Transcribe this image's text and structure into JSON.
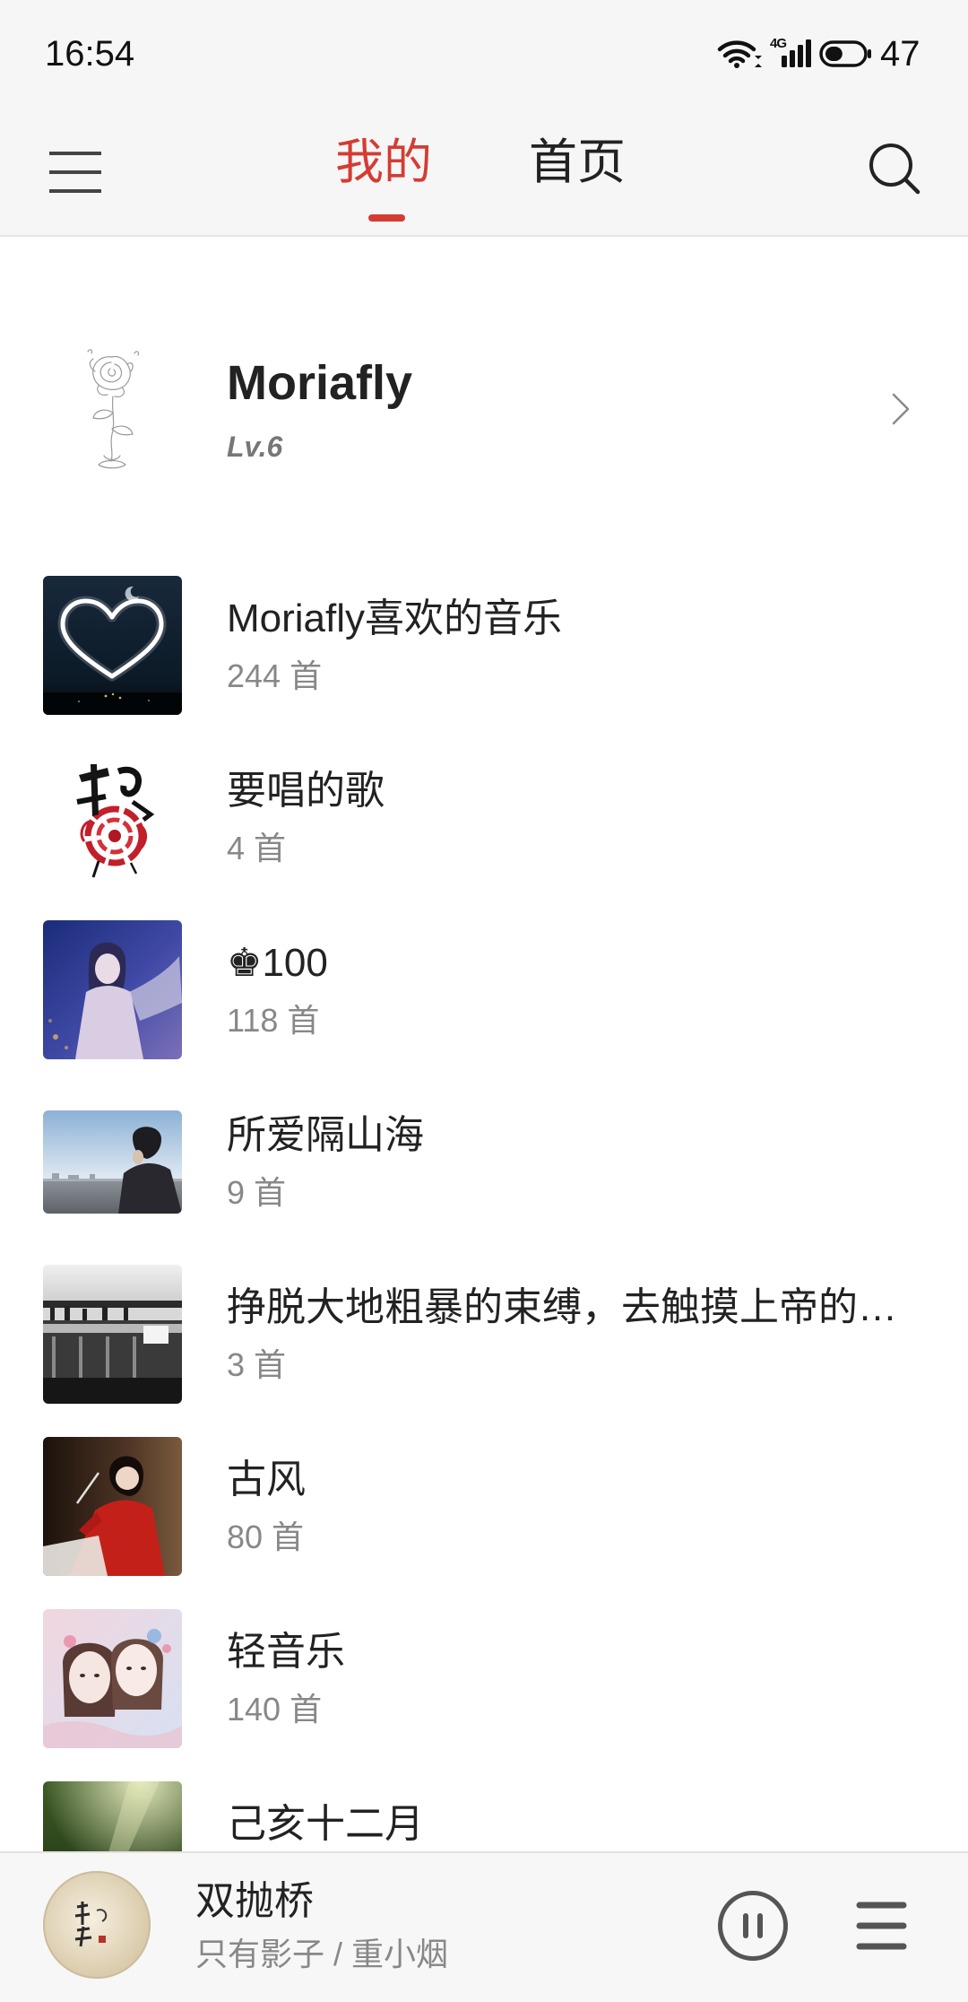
{
  "status_bar": {
    "time": "16:54",
    "network": "4G",
    "battery": "47",
    "icons": [
      "wifi-icon",
      "signal-icon",
      "battery-icon"
    ]
  },
  "header": {
    "tabs": [
      {
        "label": "我的",
        "active": true
      },
      {
        "label": "首页",
        "active": false
      }
    ],
    "icons": {
      "menu": "menu-icon",
      "search": "search-icon"
    }
  },
  "profile": {
    "name": "Moriafly",
    "level": "Lv.6",
    "icons": {
      "chevron": "chevron-right-icon"
    }
  },
  "playlists": [
    {
      "title": "Moriafly喜欢的音乐",
      "count": "244 首"
    },
    {
      "title": "要唱的歌",
      "count": "4 首"
    },
    {
      "title": "♚100",
      "count": "118 首"
    },
    {
      "title": "所爱隔山海",
      "count": "9 首"
    },
    {
      "title": "挣脱大地粗暴的束缚，去触摸上帝的…",
      "count": "3 首"
    },
    {
      "title": "古风",
      "count": "80 首"
    },
    {
      "title": "轻音乐",
      "count": "140 首"
    },
    {
      "title": "己亥十二月"
    }
  ],
  "player": {
    "title": "双抛桥",
    "subtitle": "只有影子 / 重小烟",
    "icons": {
      "pause": "pause-icon",
      "queue": "playlist-icon"
    }
  },
  "colors": {
    "accent": "#d43c33",
    "text_primary": "#222222",
    "text_secondary": "#888888",
    "bar_background": "#f6f6f6"
  }
}
